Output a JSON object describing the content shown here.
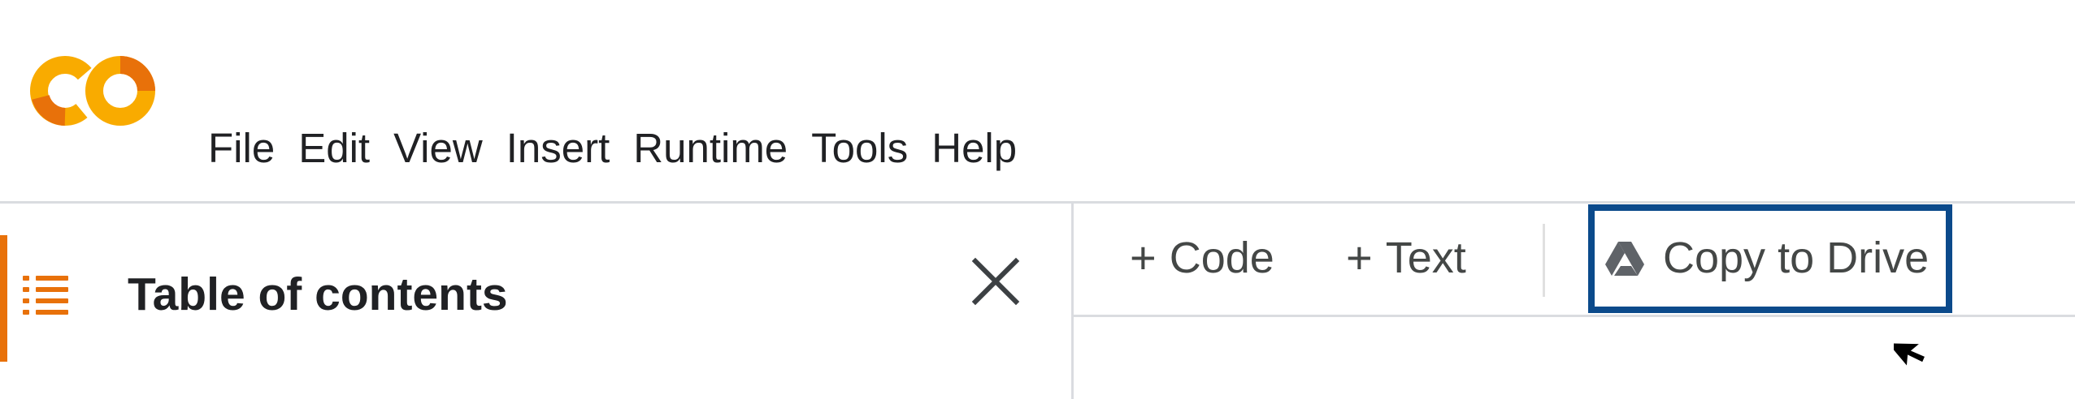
{
  "menu": {
    "items": [
      "File",
      "Edit",
      "View",
      "Insert",
      "Runtime",
      "Tools",
      "Help"
    ]
  },
  "sidebar": {
    "title": "Table of contents",
    "icon": "list-icon",
    "close_icon": "close-icon"
  },
  "toolbar": {
    "add_code": {
      "plus": "+",
      "label": "Code"
    },
    "add_text": {
      "plus": "+",
      "label": "Text"
    },
    "copy_to_drive": {
      "label": "Copy to Drive",
      "icon": "google-drive-icon"
    }
  },
  "colors": {
    "logo_orange": "#F9AB00",
    "logo_dark_orange": "#E8710A",
    "highlight_border": "#0B4A8B",
    "divider": "#DADCE0",
    "text": "#202124"
  }
}
